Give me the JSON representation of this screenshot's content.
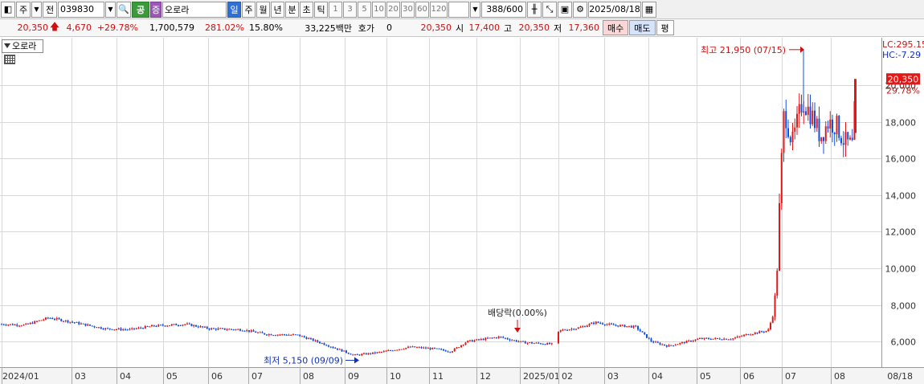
{
  "toolbar": {
    "market_label": "주",
    "period_label": "전",
    "code": "039830",
    "gong_label": "공",
    "jeung_label": "증",
    "stock_name": "오로라",
    "periods": [
      "일",
      "주",
      "월",
      "년",
      "분",
      "초",
      "틱"
    ],
    "intervals": [
      "1",
      "3",
      "5",
      "10",
      "20",
      "30",
      "60",
      "120"
    ],
    "count": "388/600",
    "date": "2025/08/18"
  },
  "info": {
    "price": "20,350",
    "change": "4,670",
    "change_pct": "+29.78%",
    "volume": "1,700,579",
    "volume_ratio": "281.02%",
    "turnover": "15.80%",
    "amount": "33,225백만",
    "hoga_label": "호가",
    "hoga_value": "0",
    "hoga_price": "20,350",
    "open_label": "시",
    "open": "17,400",
    "high_label": "고",
    "high": "20,350",
    "low_label": "저",
    "low": "17,360",
    "buy_label": "매수",
    "sell_label": "매도",
    "eq_label": "평"
  },
  "chart": {
    "legend_name": "오로라",
    "lc_label": "LC:295.15",
    "hc_label": "HC:-7.29",
    "current_price_label": "20,350",
    "current_pct_label": "29.78%",
    "high_annotation": "최고 21,950 (07/15)",
    "low_annotation": "최저 5,150 (09/09)",
    "dividend_annotation": "배당락(0.00%)",
    "y_ticks": [
      "20,000",
      "18,000",
      "16,000",
      "14,000",
      "12,000",
      "10,000",
      "8,000",
      "6,000"
    ],
    "x_ticks": [
      "2024/01",
      "03",
      "04",
      "05",
      "06",
      "07",
      "08",
      "09",
      "10",
      "11",
      "12",
      "2025/01",
      "02",
      "03",
      "04",
      "05",
      "06",
      "07",
      "08"
    ],
    "x_end_label": "08/18",
    "colors": {
      "up": "#e01818",
      "down": "#1050e0",
      "grid": "#d8d8d8",
      "axis_bg": "#f4f4f4"
    }
  },
  "chart_data": {
    "type": "candlestick",
    "title": "오로라",
    "ylim": [
      4600,
      22600
    ],
    "x_label_months": [
      "2024/01",
      "03",
      "04",
      "05",
      "06",
      "07",
      "08",
      "09",
      "10",
      "11",
      "12",
      "2025/01",
      "02",
      "03",
      "04",
      "05",
      "06",
      "07",
      "08"
    ],
    "price_path": [
      [
        0,
        6950
      ],
      [
        30,
        6900
      ],
      [
        60,
        7300
      ],
      [
        90,
        7050
      ],
      [
        130,
        6700
      ],
      [
        160,
        6650
      ],
      [
        190,
        6850
      ],
      [
        230,
        6950
      ],
      [
        260,
        6700
      ],
      [
        300,
        6650
      ],
      [
        330,
        6400
      ],
      [
        370,
        6350
      ],
      [
        400,
        5900
      ],
      [
        440,
        5250
      ],
      [
        470,
        5400
      ],
      [
        510,
        5700
      ],
      [
        540,
        5600
      ],
      [
        560,
        5450
      ],
      [
        580,
        6000
      ],
      [
        620,
        6250
      ],
      [
        650,
        5950
      ],
      [
        688,
        5850
      ],
      [
        695,
        6600
      ],
      [
        720,
        6750
      ],
      [
        740,
        7050
      ],
      [
        760,
        6900
      ],
      [
        790,
        6800
      ],
      [
        810,
        6000
      ],
      [
        830,
        5750
      ],
      [
        870,
        6150
      ],
      [
        910,
        6150
      ],
      [
        930,
        6400
      ],
      [
        955,
        6600
      ],
      [
        962,
        7600
      ],
      [
        966,
        9700
      ],
      [
        970,
        14500
      ],
      [
        975,
        18700
      ],
      [
        985,
        16800
      ],
      [
        998,
        19200
      ],
      [
        1010,
        18300
      ],
      [
        1020,
        17200
      ],
      [
        1030,
        18000
      ],
      [
        1040,
        17800
      ],
      [
        1050,
        16900
      ],
      [
        1060,
        16700
      ],
      [
        1065,
        20350
      ]
    ],
    "current": 20350,
    "high": {
      "value": 21950,
      "date": "07/15"
    },
    "low": {
      "value": 5150,
      "date": "09/09"
    }
  }
}
